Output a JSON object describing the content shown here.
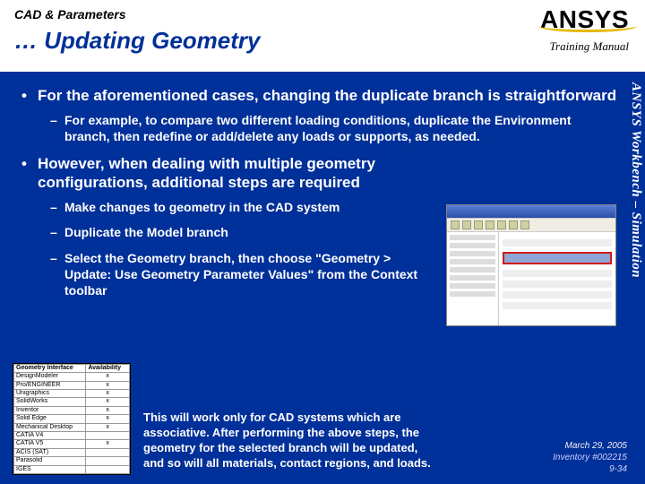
{
  "header": {
    "section": "CAD & Parameters",
    "title": "… Updating Geometry",
    "logo_text": "ANSYS",
    "training_manual": "Training Manual"
  },
  "side_label": "ANSYS Workbench – Simulation",
  "content": {
    "b1": "For the aforementioned cases, changing the duplicate branch is straightforward",
    "b1_sub1": "For example, to compare two different loading conditions, duplicate the Environment branch, then redefine or add/delete any loads or supports, as needed.",
    "b2": "However, when dealing with multiple geometry configurations, additional steps are required",
    "b2_sub1": "Make changes to geometry in the CAD system",
    "b2_sub2": "Duplicate the Model branch",
    "b2_sub3": "Select the Geometry branch, then choose \"Geometry > Update: Use Geometry Parameter Values\" from the Context toolbar",
    "note": "This will work only for CAD systems which are associative.  After performing the above steps, the geometry for the selected branch will be updated, and so will all materials, contact regions, and loads."
  },
  "table": {
    "headers": [
      "Geometry Interface",
      "Availability"
    ],
    "rows": [
      [
        "DesignModeler",
        "x"
      ],
      [
        "Pro/ENGINEER",
        "x"
      ],
      [
        "Unigraphics",
        "x"
      ],
      [
        "SolidWorks",
        "x"
      ],
      [
        "Inventor",
        "x"
      ],
      [
        "Solid Edge",
        "x"
      ],
      [
        "Mechanical Desktop",
        "x"
      ],
      [
        "CATIA V4",
        ""
      ],
      [
        "CATIA V5",
        "x"
      ],
      [
        "ACIS (SAT)",
        ""
      ],
      [
        "Parasolid",
        ""
      ],
      [
        "IGES",
        ""
      ]
    ]
  },
  "footer": {
    "date": "March 29, 2005",
    "inventory": "Inventory #002215",
    "page": "9-34"
  }
}
